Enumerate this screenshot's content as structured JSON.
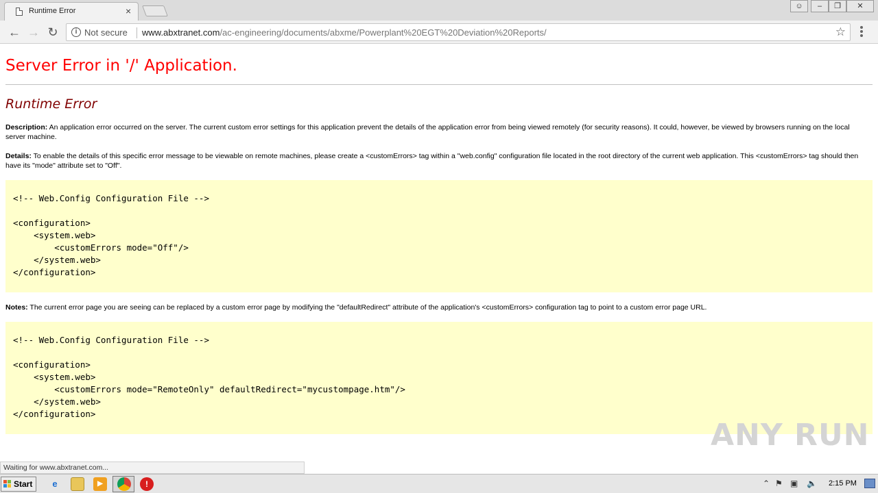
{
  "browser": {
    "tab_title": "Runtime Error",
    "security_label": "Not secure",
    "url_host": "www.abxtranet.com",
    "url_path": "/ac-engineering/documents/abxme/Powerplant%20EGT%20Deviation%20Reports/",
    "status_text": "Waiting for www.abxtranet.com..."
  },
  "page": {
    "heading": "Server Error in '/' Application.",
    "subheading": "Runtime Error",
    "description_label": "Description:",
    "description_text": " An application error occurred on the server. The current custom error settings for this application prevent the details of the application error from being viewed remotely (for security reasons). It could, however, be viewed by browsers running on the local server machine.",
    "details_label": "Details:",
    "details_text": " To enable the details of this specific error message to be viewable on remote machines, please create a <customErrors> tag within a \"web.config\" configuration file located in the root directory of the current web application. This <customErrors> tag should then have its \"mode\" attribute set to \"Off\".",
    "code1": "\n<!-- Web.Config Configuration File -->\n\n<configuration>\n    <system.web>\n        <customErrors mode=\"Off\"/>\n    </system.web>\n</configuration>",
    "notes_label": "Notes:",
    "notes_text": " The current error page you are seeing can be replaced by a custom error page by modifying the \"defaultRedirect\" attribute of the application's <customErrors> configuration tag to point to a custom error page URL.",
    "code2": "\n<!-- Web.Config Configuration File -->\n\n<configuration>\n    <system.web>\n        <customErrors mode=\"RemoteOnly\" defaultRedirect=\"mycustompage.htm\"/>\n    </system.web>\n</configuration>"
  },
  "watermark": "ANY RUN",
  "taskbar": {
    "start_label": "Start",
    "clock": "2:15 PM"
  },
  "colors": {
    "heading": "#ff0000",
    "subheading": "#800000",
    "code_bg": "#ffffcc"
  }
}
